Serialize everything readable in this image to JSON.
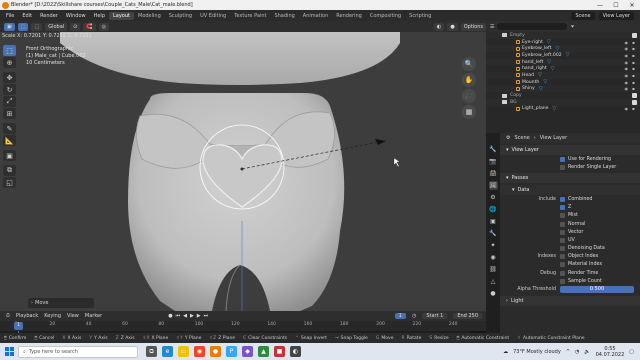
{
  "window": {
    "title": "Blender* [D:\\2022\\Skillshare courses\\Couple_Cats_Male\\Cat_male.blend]",
    "controls": [
      "—",
      "☐",
      "✕"
    ]
  },
  "menu": {
    "items": [
      "File",
      "Edit",
      "Render",
      "Window",
      "Help"
    ],
    "workspaces": [
      "Layout",
      "Modeling",
      "Sculpting",
      "UV Editing",
      "Texture Paint",
      "Shading",
      "Animation",
      "Rendering",
      "Compositing",
      "Scripting"
    ],
    "active_workspace": "Layout",
    "scene": "Scene",
    "view_layer": "View Layer"
  },
  "viewport": {
    "header": {
      "orientation": "Global",
      "options": "Options"
    },
    "scale_readout": "Scale X: 0.7201  Y: 0.7201  Z: 0.7201",
    "view_name": "Front Orthographic",
    "object_info": "(1) Male_cat | Cube.002",
    "units": "10 Centimeters",
    "operator_panel": "Move"
  },
  "outliner": {
    "rows": [
      {
        "label": "Empty",
        "type": "collection"
      },
      {
        "label": "Eye-right",
        "type": "object"
      },
      {
        "label": "Eyebrow_left",
        "type": "object"
      },
      {
        "label": "Eyebrow_left.002",
        "type": "object"
      },
      {
        "label": "hand_left",
        "type": "object"
      },
      {
        "label": "hand_right",
        "type": "object"
      },
      {
        "label": "Head",
        "type": "object"
      },
      {
        "label": "Mounth",
        "type": "object"
      },
      {
        "label": "Shiny",
        "type": "object"
      },
      {
        "label": "Copy",
        "type": "collection"
      },
      {
        "label": "BG",
        "type": "collection"
      },
      {
        "label": "Light_plane",
        "type": "object"
      }
    ]
  },
  "properties": {
    "scene": "Scene",
    "view_layer": "View Layer",
    "view_layer_section": "View Layer",
    "use_for_rendering": "Use for Rendering",
    "render_single_layer": "Render Single Layer",
    "passes_section": "Passes",
    "data_section": "Data",
    "include_label": "Include",
    "include": [
      {
        "label": "Combined",
        "on": true
      },
      {
        "label": "Z",
        "on": true
      },
      {
        "label": "Mist",
        "on": false
      },
      {
        "label": "Normal",
        "on": false
      },
      {
        "label": "Vector",
        "on": false
      },
      {
        "label": "UV",
        "on": false
      },
      {
        "label": "Denoising Data",
        "on": false
      }
    ],
    "indexes_label": "Indexes",
    "indexes": [
      {
        "label": "Object Index",
        "on": false
      },
      {
        "label": "Material Index",
        "on": false
      }
    ],
    "debug_label": "Debug",
    "debug": [
      {
        "label": "Render Time",
        "on": false
      },
      {
        "label": "Sample Count",
        "on": false
      }
    ],
    "alpha_threshold_label": "Alpha Threshold",
    "alpha_threshold": "0.500",
    "light_section": "Light"
  },
  "timeline": {
    "menus": [
      "Playback",
      "Keying",
      "View",
      "Marker"
    ],
    "current_frame": "1",
    "start_label": "Start",
    "start": "1",
    "end_label": "End",
    "end": "250",
    "ticks": [
      "1",
      "20",
      "40",
      "60",
      "80",
      "100",
      "120",
      "140",
      "160",
      "180",
      "200",
      "220",
      "240"
    ]
  },
  "statusbar": {
    "items": [
      "Confirm",
      "Cancel",
      "X Axis",
      "Y Axis",
      "Z Axis",
      "X Plane",
      "Y Plane",
      "Z Plane",
      "Clear Constraints",
      "Snap Invert",
      "Snap Toggle",
      "Move",
      "Rotate",
      "Resize",
      "Automatic Constraint",
      "Automatic Constraint Plane"
    ]
  },
  "taskbar": {
    "search_placeholder": "Type here to search",
    "weather": "73°F  Mostly cloudy",
    "time": "0:55",
    "date": "04.07.2022"
  },
  "colors": {
    "accent": "#4772b3",
    "viewport_bg": "#3d3d3d",
    "model": "#c9c9c9"
  }
}
